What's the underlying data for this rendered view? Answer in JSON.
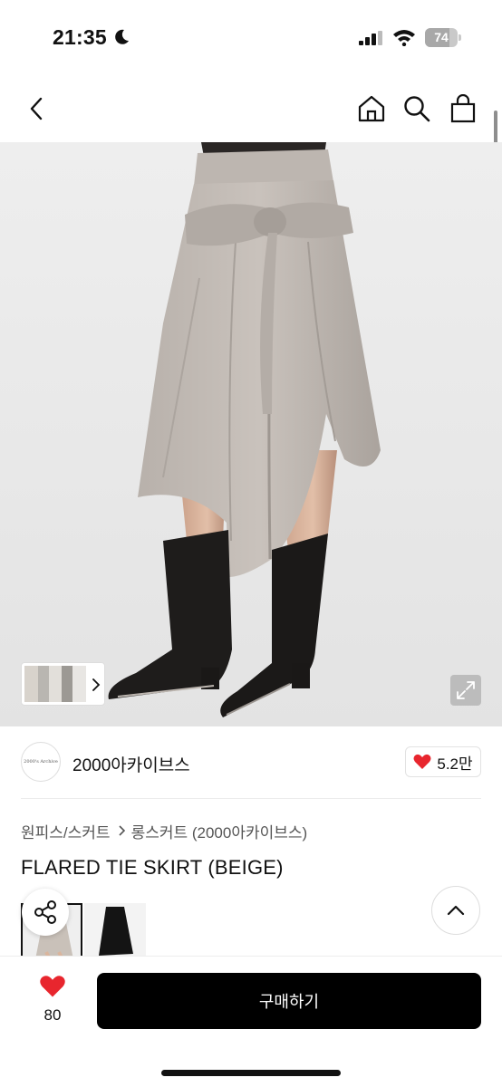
{
  "status_bar": {
    "time": "21:35",
    "battery_level": "74",
    "battery_fraction": 0.74
  },
  "nav": {
    "back_icon": "chevron-left-icon",
    "home_icon": "home-icon",
    "search_icon": "search-icon",
    "bag_icon": "shopping-bag-icon"
  },
  "shop": {
    "name": "2000아카이브스",
    "logo_text": "2000's Archive",
    "likes": "5.2만"
  },
  "breadcrumb": {
    "category": "원피스/스커트",
    "subcategory": "롱스커트 (2000아카이브스)"
  },
  "product": {
    "title": "FLARED TIE SKIRT (BEIGE)"
  },
  "bottom_bar": {
    "wish_count": "80",
    "buy_label": "구매하기"
  },
  "colors": {
    "accent_red": "#e8262e",
    "buy_button": "#000000"
  }
}
